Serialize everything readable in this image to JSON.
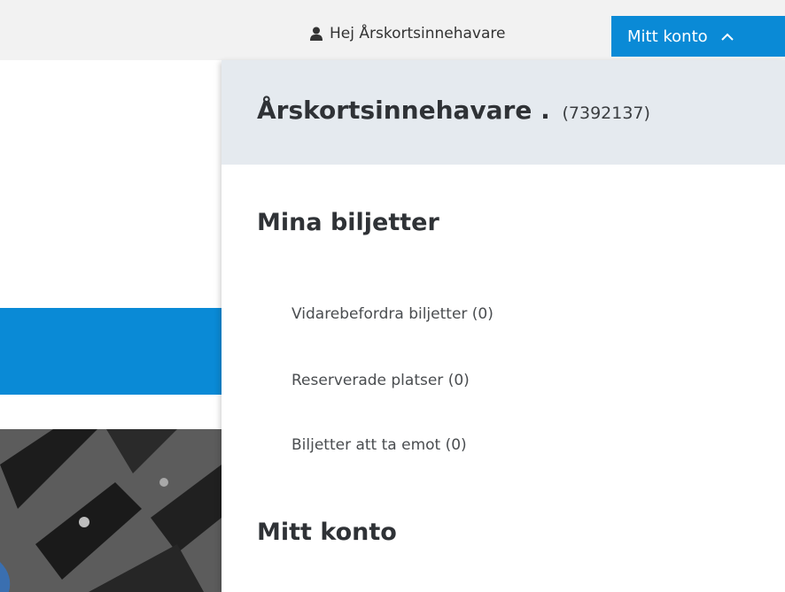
{
  "topbar": {
    "greeting": "Hej Årskortsinnehavare",
    "account_button": "Mitt konto",
    "user_icon": "user-icon",
    "chevron_icon": "chevron-up-icon"
  },
  "dropdown": {
    "holder_name": "Årskortsinnehavare .",
    "holder_number": "(7392137)",
    "tickets_section": {
      "title": "Mina biljetter",
      "items": [
        {
          "label": "Vidarebefordra biljetter (0)"
        },
        {
          "label": "Reserverade platser (0)"
        },
        {
          "label": "Biljetter att ta emot (0)"
        }
      ]
    },
    "account_section": {
      "title": "Mitt konto"
    }
  },
  "colors": {
    "accent_blue": "#0a8ad6",
    "topbar_bg": "#f2f2f2",
    "panel_header_bg": "#e5eaef",
    "text_dark": "#2f3236"
  }
}
